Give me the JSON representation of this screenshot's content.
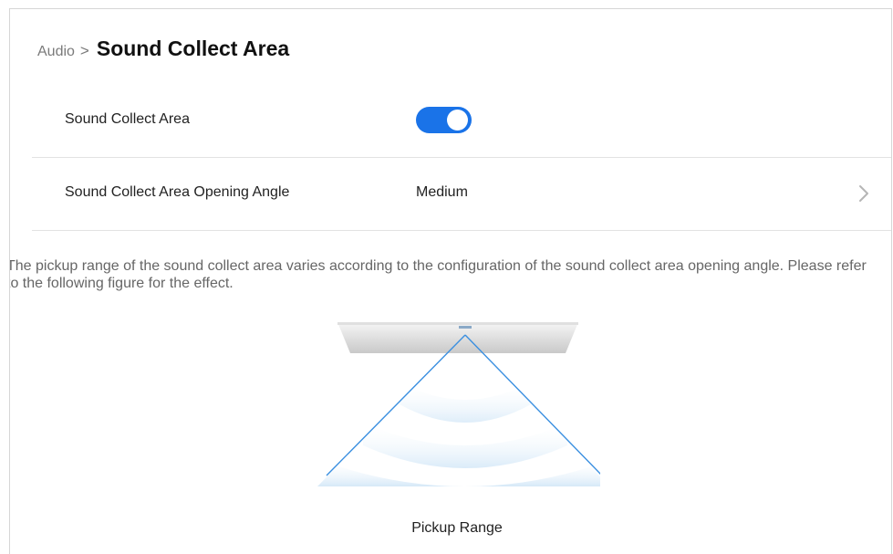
{
  "breadcrumb": {
    "parent": "Audio",
    "separator": ">",
    "current": "Sound Collect Area"
  },
  "settings": [
    {
      "label": "Sound Collect Area",
      "control": "toggle",
      "enabled": true
    },
    {
      "label": "Sound Collect Area Opening Angle",
      "value": "Medium",
      "control": "chevron-right-icon"
    }
  ],
  "description": "The pickup range of the sound collect area varies according to the configuration of the sound collect area opening angle. Please refer to the following figure for the effect.",
  "figure": {
    "caption": "Pickup Range"
  },
  "colors": {
    "accent": "#1a73e8",
    "beam_line": "#3a8fe0",
    "wave": "#dcebf8"
  }
}
